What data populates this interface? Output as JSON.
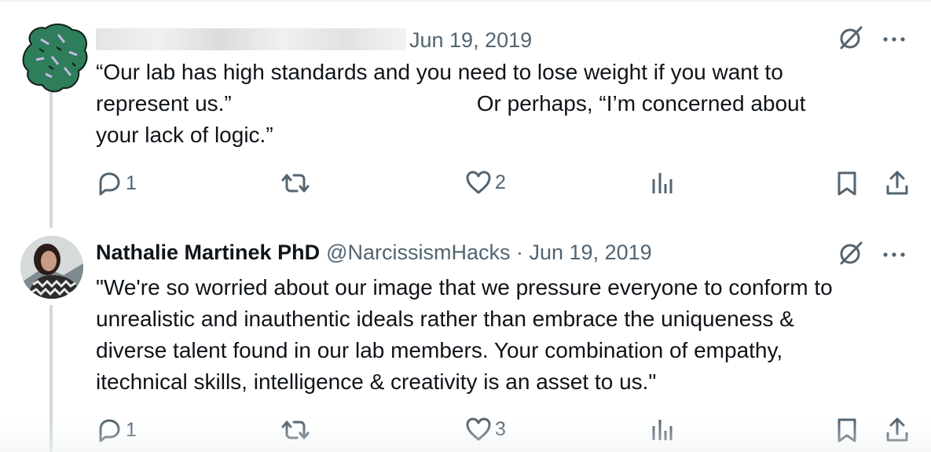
{
  "tweets": [
    {
      "author_name": "",
      "handle": "",
      "date": "Jun 19, 2019",
      "body_line1": "“Our lab has high standards and you need to lose weight if you want to",
      "body_line2a": "represent us.”",
      "body_line2b": "Or perhaps, “I’m concerned about",
      "body_line3": "your lack of logic.”",
      "replies": "1",
      "retweets": "",
      "likes": "2"
    },
    {
      "author_name": "Nathalie Martinek PhD",
      "handle": "@NarcissismHacks",
      "separator": " · ",
      "date": "Jun 19, 2019",
      "body_line1": "\"We're so worried about our image that we pressure everyone to conform to",
      "body_line2": "unrealistic and inauthentic ideals rather than embrace the uniqueness &",
      "body_line3": "diverse talent found in our lab members. Your combination of empathy,",
      "body_line4": "itechnical skills, intelligence & creativity is an asset to us.\"",
      "replies": "1",
      "retweets": "",
      "likes": "3"
    }
  ],
  "icons": {
    "grok": "grok-icon",
    "more": "more-icon",
    "reply": "reply-icon",
    "retweet": "retweet-icon",
    "like": "like-icon",
    "views": "views-icon",
    "bookmark": "bookmark-icon",
    "share": "share-icon"
  },
  "colors": {
    "text": "#0f1419",
    "muted": "#536471",
    "avatar_green": "#2e7d5b",
    "thread": "#cfd9de"
  }
}
